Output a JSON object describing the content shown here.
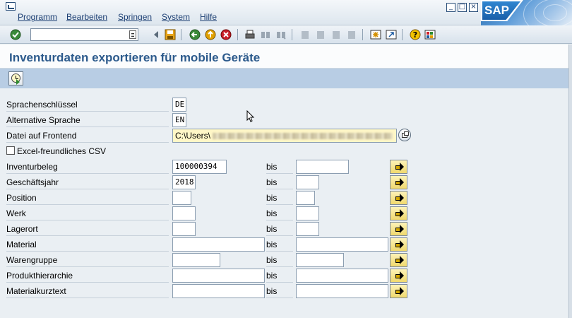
{
  "menu": {
    "items": [
      "Programm",
      "Bearbeiten",
      "Springen",
      "System",
      "Hilfe"
    ]
  },
  "window": {
    "logo_text": "SAP"
  },
  "toolbar": {
    "command_value": ""
  },
  "page": {
    "title": "Inventurdaten exportieren für mobile Geräte"
  },
  "form": {
    "language_key": {
      "label": "Sprachenschlüssel",
      "value": "DE"
    },
    "alt_language": {
      "label": "Alternative Sprache",
      "value": "EN"
    },
    "frontend_file": {
      "label": "Datei auf Frontend",
      "value": "C:\\Users\\"
    },
    "csv_option": {
      "label": "Excel-freundliches CSV",
      "checked": false
    },
    "ranges": [
      {
        "label": "Inventurbeleg",
        "from": "100000394",
        "to": ""
      },
      {
        "label": "Geschäftsjahr",
        "from": "2018",
        "to": ""
      },
      {
        "label": "Position",
        "from": "",
        "to": ""
      },
      {
        "label": "Werk",
        "from": "",
        "to": ""
      },
      {
        "label": "Lagerort",
        "from": "",
        "to": ""
      },
      {
        "label": "Material",
        "from": "",
        "to": ""
      },
      {
        "label": "Warengruppe",
        "from": "",
        "to": ""
      },
      {
        "label": "Produkthierarchie",
        "from": "",
        "to": ""
      },
      {
        "label": "Materialkurztext",
        "from": "",
        "to": ""
      }
    ],
    "to_label": "bis"
  },
  "colors": {
    "title": "#2c5a8c",
    "app_toolbar": "#b8cde4",
    "required_field": "#fff7c7"
  }
}
